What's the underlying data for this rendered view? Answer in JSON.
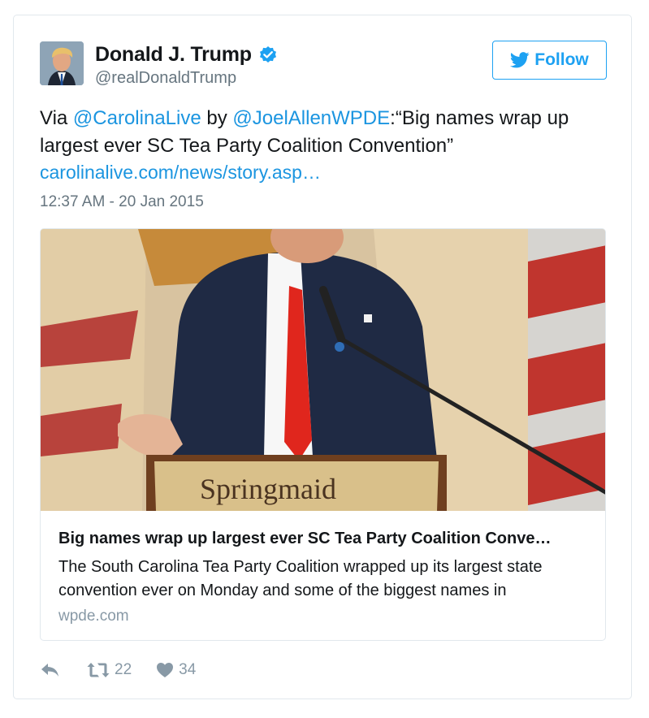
{
  "user": {
    "display_name": "Donald J. Trump",
    "handle": "@realDonaldTrump",
    "verified": true
  },
  "follow_label": "Follow",
  "tweet": {
    "prefix": "Via ",
    "mention1": "@CarolinaLive",
    "by": " by ",
    "mention2": "@JoelAllenWPDE",
    "quote": ":“Big names wrap up largest ever SC Tea Party Coalition Convention”",
    "link": "carolinalive.com/news/story.asp…",
    "timestamp": "12:37 AM - 20 Jan 2015"
  },
  "card": {
    "image_text": "Springmaid",
    "title": "Big names wrap up largest ever SC Tea Party Coalition Conve…",
    "description": "The South Carolina Tea Party Coalition wrapped up its largest state convention ever on Monday and some of the biggest names in",
    "domain": "wpde.com"
  },
  "actions": {
    "retweets": "22",
    "likes": "34"
  },
  "colors": {
    "link": "#1b95e0",
    "follow": "#1da1f2",
    "muted": "#66757f"
  }
}
